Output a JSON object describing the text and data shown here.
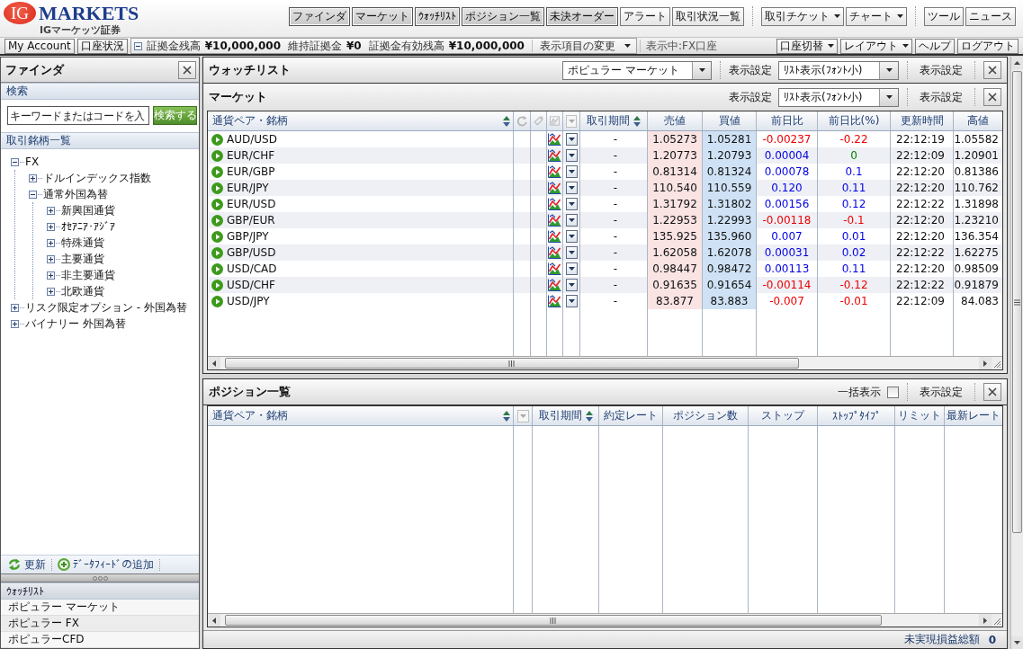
{
  "header": {
    "logo": {
      "mark": "IG",
      "wordmark": "MARKETS",
      "subtitle": "IGマーケッツ証券"
    },
    "nav_groups": [
      {
        "items": [
          {
            "label": "ファインダ",
            "kind": "button",
            "selected": true
          },
          {
            "label": "マーケット",
            "kind": "button",
            "selected": true
          },
          {
            "label": "ｳｫｯﾁﾘｽﾄ",
            "kind": "button",
            "selected": true
          },
          {
            "label": "ポジション一覧",
            "kind": "button",
            "selected": true
          },
          {
            "label": "未決オーダー",
            "kind": "button",
            "selected": true
          },
          {
            "label": "アラート",
            "kind": "button",
            "selected": false
          },
          {
            "label": "取引状況一覧",
            "kind": "button",
            "selected": false
          }
        ]
      },
      {
        "items": [
          {
            "label": "取引チケット",
            "kind": "dropdown",
            "selected": false
          },
          {
            "label": "チャート",
            "kind": "dropdown",
            "selected": false
          }
        ]
      },
      {
        "items": [
          {
            "label": "ツール",
            "kind": "button",
            "selected": false
          },
          {
            "label": "ニュース",
            "kind": "button",
            "selected": false
          }
        ]
      }
    ]
  },
  "account_bar": {
    "buttons": [
      "My Account",
      "口座状況"
    ],
    "balances": {
      "expanded": true,
      "items": [
        {
          "label": "証拠金残高",
          "value": "¥10,000,000"
        },
        {
          "label": "維持証拠金",
          "value": "¥0"
        },
        {
          "label": "証拠金有効残高",
          "value": "¥10,000,000"
        }
      ],
      "fields_dropdown": "表示項目の変更"
    },
    "status": "表示中:FX口座",
    "actions": [
      {
        "label": "口座切替",
        "kind": "dropdown"
      },
      {
        "label": "レイアウト",
        "kind": "dropdown"
      },
      {
        "label": "ヘルプ",
        "kind": "button"
      },
      {
        "label": "ログアウト",
        "kind": "button"
      }
    ]
  },
  "finder": {
    "title": "ファインダ",
    "search": {
      "heading": "検索",
      "placeholder": "キーワードまたはコードを入",
      "button": "検索する"
    },
    "instruments": {
      "heading": "取引銘柄一覧",
      "tree": [
        {
          "label": "FX",
          "expanded": true,
          "children": [
            {
              "label": "ドルインデックス指数",
              "expanded": false
            },
            {
              "label": "通常外国為替",
              "expanded": true,
              "children": [
                {
                  "label": "新興国通貨",
                  "expanded": false
                },
                {
                  "label": "ｵｾｱﾆｱ･ｱｼﾞｱ",
                  "expanded": false
                },
                {
                  "label": "特殊通貨",
                  "expanded": false
                },
                {
                  "label": "主要通貨",
                  "expanded": false
                },
                {
                  "label": "非主要通貨",
                  "expanded": false
                },
                {
                  "label": "北欧通貨",
                  "expanded": false
                }
              ]
            }
          ]
        },
        {
          "label": "リスク限定オプション - 外国為替",
          "expanded": false
        },
        {
          "label": "バイナリー 外国為替",
          "expanded": false
        }
      ]
    },
    "toolbar": [
      {
        "label": "更新",
        "kind": "refresh"
      },
      {
        "label": "ﾃﾞｰﾀﾌｨｰﾄﾞの追加",
        "kind": "add"
      }
    ],
    "watchlists": {
      "heading": "ｳｫｯﾁﾘｽﾄ",
      "items": [
        "ポピュラー マーケット",
        "ポピュラー FX",
        "ポピュラーCFD"
      ]
    }
  },
  "watchlist_panel": {
    "title": "ウォッチリスト",
    "list_select": "ポピュラー マーケット",
    "view_label": "表示設定",
    "view_select": "ﾘｽﾄ表示(ﾌｫﾝﾄ小)",
    "settings_button": "表示設定",
    "market": {
      "title": "マーケット",
      "view_label": "表示設定",
      "view_select": "ﾘｽﾄ表示(ﾌｫﾝﾄ小)",
      "settings_button": "表示設定",
      "columns": [
        {
          "label": "通貨ペア・銘柄",
          "kind": "text",
          "sortable": true
        },
        {
          "kind": "refresh",
          "sortable": false
        },
        {
          "kind": "tag",
          "sortable": false
        },
        {
          "kind": "chart",
          "sortable": false
        },
        {
          "kind": "menu",
          "sortable": false
        },
        {
          "label": "取引期間",
          "kind": "text",
          "sortable": true
        },
        {
          "label": "売値",
          "kind": "text",
          "sortable": false
        },
        {
          "label": "買値",
          "kind": "text",
          "sortable": false
        },
        {
          "label": "前日比",
          "kind": "text",
          "sortable": false
        },
        {
          "label": "前日比(%)",
          "kind": "text",
          "sortable": false
        },
        {
          "label": "更新時間",
          "kind": "text",
          "sortable": false
        },
        {
          "label": "高値",
          "kind": "text",
          "sortable": false
        }
      ],
      "rows": [
        {
          "symbol": "AUD/USD",
          "period": "-",
          "bid": "1.05273",
          "ask": "1.05281",
          "change": {
            "text": "-0.00237",
            "color": "#ee0000"
          },
          "change_pct": {
            "text": "-0.22",
            "color": "#ee0000"
          },
          "time": "22:12:19",
          "high": "1.05582"
        },
        {
          "symbol": "EUR/CHF",
          "period": "-",
          "bid": "1.20773",
          "ask": "1.20793",
          "change": {
            "text": "0.00004",
            "color": "#0000e6"
          },
          "change_pct": {
            "text": "0",
            "color": "#008000"
          },
          "time": "22:12:09",
          "high": "1.20901"
        },
        {
          "symbol": "EUR/GBP",
          "period": "-",
          "bid": "0.81314",
          "ask": "0.81324",
          "change": {
            "text": "0.00078",
            "color": "#0000e6"
          },
          "change_pct": {
            "text": "0.1",
            "color": "#0000e6"
          },
          "time": "22:12:20",
          "high": "0.81386"
        },
        {
          "symbol": "EUR/JPY",
          "period": "-",
          "bid": "110.540",
          "ask": "110.559",
          "change": {
            "text": "0.120",
            "color": "#0000e6"
          },
          "change_pct": {
            "text": "0.11",
            "color": "#0000e6"
          },
          "time": "22:12:20",
          "high": "110.762"
        },
        {
          "symbol": "EUR/USD",
          "period": "-",
          "bid": "1.31792",
          "ask": "1.31802",
          "change": {
            "text": "0.00156",
            "color": "#0000e6"
          },
          "change_pct": {
            "text": "0.12",
            "color": "#0000e6"
          },
          "time": "22:12:22",
          "high": "1.31898"
        },
        {
          "symbol": "GBP/EUR",
          "period": "-",
          "bid": "1.22953",
          "ask": "1.22993",
          "change": {
            "text": "-0.00118",
            "color": "#ee0000"
          },
          "change_pct": {
            "text": "-0.1",
            "color": "#ee0000"
          },
          "time": "22:12:20",
          "high": "1.23210"
        },
        {
          "symbol": "GBP/JPY",
          "period": "-",
          "bid": "135.925",
          "ask": "135.960",
          "change": {
            "text": "0.007",
            "color": "#0000e6"
          },
          "change_pct": {
            "text": "0.01",
            "color": "#0000e6"
          },
          "time": "22:12:20",
          "high": "136.354"
        },
        {
          "symbol": "GBP/USD",
          "period": "-",
          "bid": "1.62058",
          "ask": "1.62078",
          "change": {
            "text": "0.00031",
            "color": "#0000e6"
          },
          "change_pct": {
            "text": "0.02",
            "color": "#0000e6"
          },
          "time": "22:12:22",
          "high": "1.62275"
        },
        {
          "symbol": "USD/CAD",
          "period": "-",
          "bid": "0.98447",
          "ask": "0.98472",
          "change": {
            "text": "0.00113",
            "color": "#0000e6"
          },
          "change_pct": {
            "text": "0.11",
            "color": "#0000e6"
          },
          "time": "22:12:20",
          "high": "0.98509"
        },
        {
          "symbol": "USD/CHF",
          "period": "-",
          "bid": "0.91635",
          "ask": "0.91654",
          "change": {
            "text": "-0.00114",
            "color": "#ee0000"
          },
          "change_pct": {
            "text": "-0.12",
            "color": "#ee0000"
          },
          "time": "22:12:22",
          "high": "0.91879"
        },
        {
          "symbol": "USD/JPY",
          "period": "-",
          "bid": "83.877",
          "ask": "83.883",
          "change": {
            "text": "-0.007",
            "color": "#ee0000"
          },
          "change_pct": {
            "text": "-0.01",
            "color": "#ee0000"
          },
          "time": "22:12:09",
          "high": "84.083"
        }
      ]
    }
  },
  "positions_panel": {
    "title": "ポジション一覧",
    "show_all": {
      "label": "一括表示",
      "checked": false
    },
    "settings_button": "表示設定",
    "columns": [
      {
        "label": "通貨ペア・銘柄",
        "kind": "text",
        "sortable": true
      },
      {
        "kind": "menu",
        "sortable": false
      },
      {
        "label": "取引期間",
        "kind": "text",
        "sortable": true
      },
      {
        "label": "約定レート",
        "kind": "text",
        "sortable": false
      },
      {
        "label": "ポジション数",
        "kind": "text",
        "sortable": false
      },
      {
        "label": "ストップ",
        "kind": "text",
        "sortable": false
      },
      {
        "label": "ｽﾄｯﾌﾟﾀｲﾌﾟ",
        "kind": "text",
        "sortable": false
      },
      {
        "label": "リミット",
        "kind": "text",
        "sortable": false
      },
      {
        "label": "最新レート",
        "kind": "text",
        "sortable": false
      }
    ],
    "footer": {
      "label": "未実現損益総額",
      "value": "0"
    }
  }
}
